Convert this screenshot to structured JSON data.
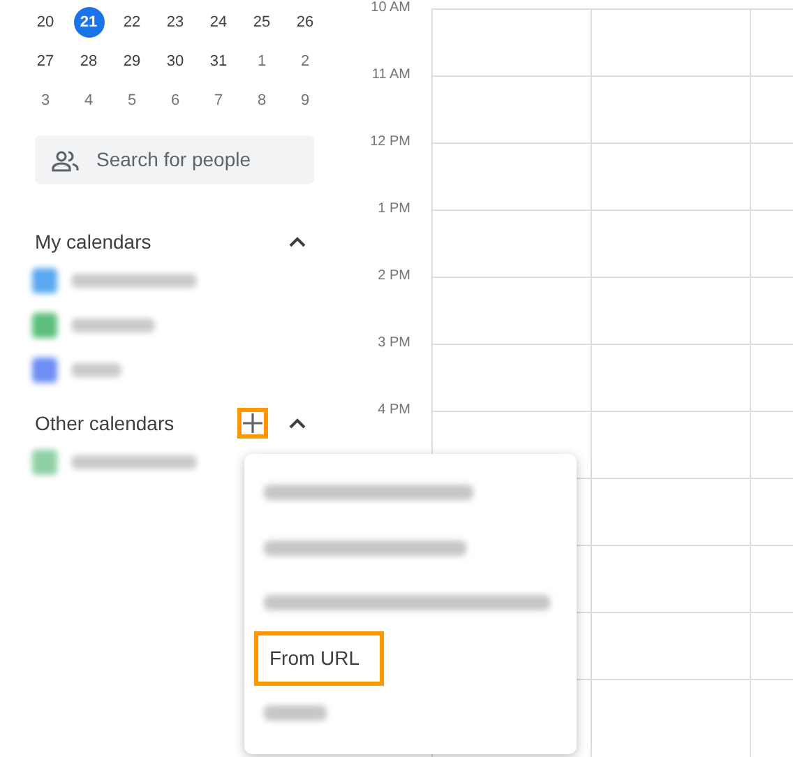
{
  "mini_calendar": {
    "weeks": [
      [
        {
          "day": "20",
          "muted": false,
          "selected": false
        },
        {
          "day": "21",
          "muted": false,
          "selected": true
        },
        {
          "day": "22",
          "muted": false,
          "selected": false
        },
        {
          "day": "23",
          "muted": false,
          "selected": false
        },
        {
          "day": "24",
          "muted": false,
          "selected": false
        },
        {
          "day": "25",
          "muted": false,
          "selected": false
        },
        {
          "day": "26",
          "muted": false,
          "selected": false
        }
      ],
      [
        {
          "day": "27",
          "muted": false,
          "selected": false
        },
        {
          "day": "28",
          "muted": false,
          "selected": false
        },
        {
          "day": "29",
          "muted": false,
          "selected": false
        },
        {
          "day": "30",
          "muted": false,
          "selected": false
        },
        {
          "day": "31",
          "muted": false,
          "selected": false
        },
        {
          "day": "1",
          "muted": true,
          "selected": false
        },
        {
          "day": "2",
          "muted": true,
          "selected": false
        }
      ],
      [
        {
          "day": "3",
          "muted": true,
          "selected": false
        },
        {
          "day": "4",
          "muted": true,
          "selected": false
        },
        {
          "day": "5",
          "muted": true,
          "selected": false
        },
        {
          "day": "6",
          "muted": true,
          "selected": false
        },
        {
          "day": "7",
          "muted": true,
          "selected": false
        },
        {
          "day": "8",
          "muted": true,
          "selected": false
        },
        {
          "day": "9",
          "muted": true,
          "selected": false
        }
      ]
    ]
  },
  "search": {
    "placeholder": "Search for people"
  },
  "my_calendars": {
    "title": "My calendars",
    "expanded": true,
    "items": [
      {
        "color": "#5aa9f0"
      },
      {
        "color": "#5cbf7d"
      },
      {
        "color": "#6f8ef5"
      }
    ]
  },
  "other_calendars": {
    "title": "Other calendars",
    "expanded": true,
    "add_highlighted": true,
    "items": [
      {
        "color": "#8fd0a4"
      }
    ]
  },
  "time_labels": [
    "10 AM",
    "11 AM",
    "12 PM",
    "1 PM",
    "2 PM",
    "3 PM",
    "4 PM"
  ],
  "menu": {
    "items": [
      {
        "kind": "blurred"
      },
      {
        "kind": "blurred"
      },
      {
        "kind": "blurred"
      },
      {
        "kind": "text",
        "label": "From URL",
        "highlighted": true
      },
      {
        "kind": "blurred"
      }
    ]
  }
}
